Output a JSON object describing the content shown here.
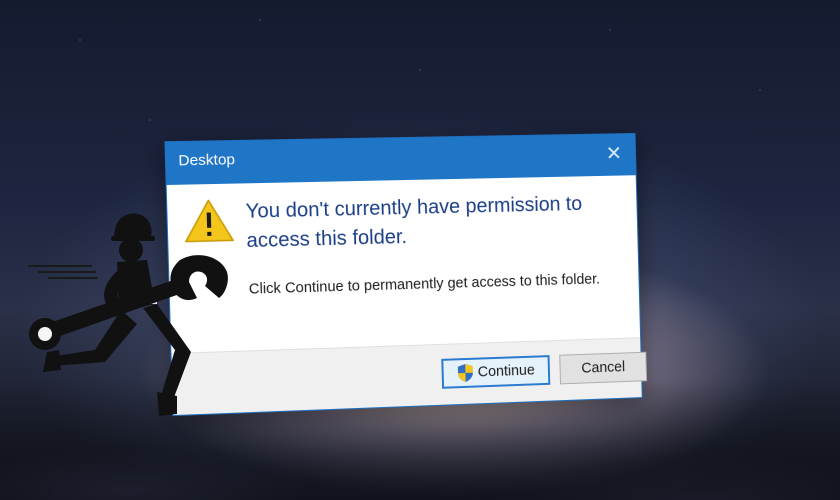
{
  "dialog": {
    "title": "Desktop",
    "close_glyph": "✕",
    "main_instruction": "You don't currently have permission to access this folder.",
    "content_text": "Click Continue to permanently get access to this folder.",
    "buttons": {
      "continue_label": "Continue",
      "cancel_label": "Cancel"
    },
    "icons": {
      "warning": "warning-icon",
      "uac_shield": "uac-shield-icon",
      "close": "close-icon"
    }
  },
  "illustration": {
    "subject": "worker-with-wrench-icon"
  },
  "colors": {
    "titlebar": "#1f75c6",
    "main_instruction_text": "#1a3d86",
    "warning_yellow": "#f4c51b",
    "footer_bg": "#f0f0f0",
    "button_focus_border": "#2a7ad0"
  }
}
